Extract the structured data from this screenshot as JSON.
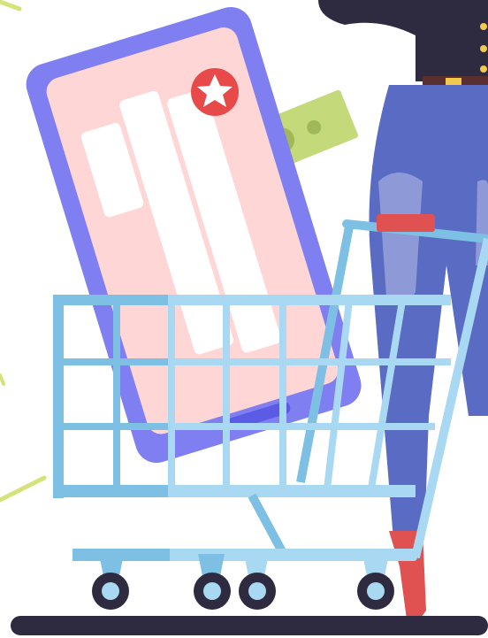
{
  "illustration": {
    "colors": {
      "phone_frame": "#7f7ff2",
      "phone_screen": "#ffd6d6",
      "phone_home_bar": "#5b5be6",
      "screen_card": "#ffffff",
      "star_badge": "#e84a4a",
      "star": "#ffffff",
      "banknote": "#c4d97a",
      "banknote_dark": "#9fb95a",
      "cart_front": "#7ec0e4",
      "cart_light": "#a9d9f2",
      "cart_handle": "#e05252",
      "wheel_tire": "#2e2a3f",
      "wheel_hub": "#a9d9f2",
      "ground": "#2e2a3f",
      "jeans": "#5a6bc4",
      "jeans_highlight": "#8e9ad8",
      "jacket": "#2e2a3f",
      "belt": "#5a2f2f",
      "shoe": "#e05252",
      "confetti": "#d6e27a"
    },
    "icons": [
      "star-icon",
      "shopping-cart-icon",
      "banknote-icon",
      "smartphone-icon"
    ]
  }
}
